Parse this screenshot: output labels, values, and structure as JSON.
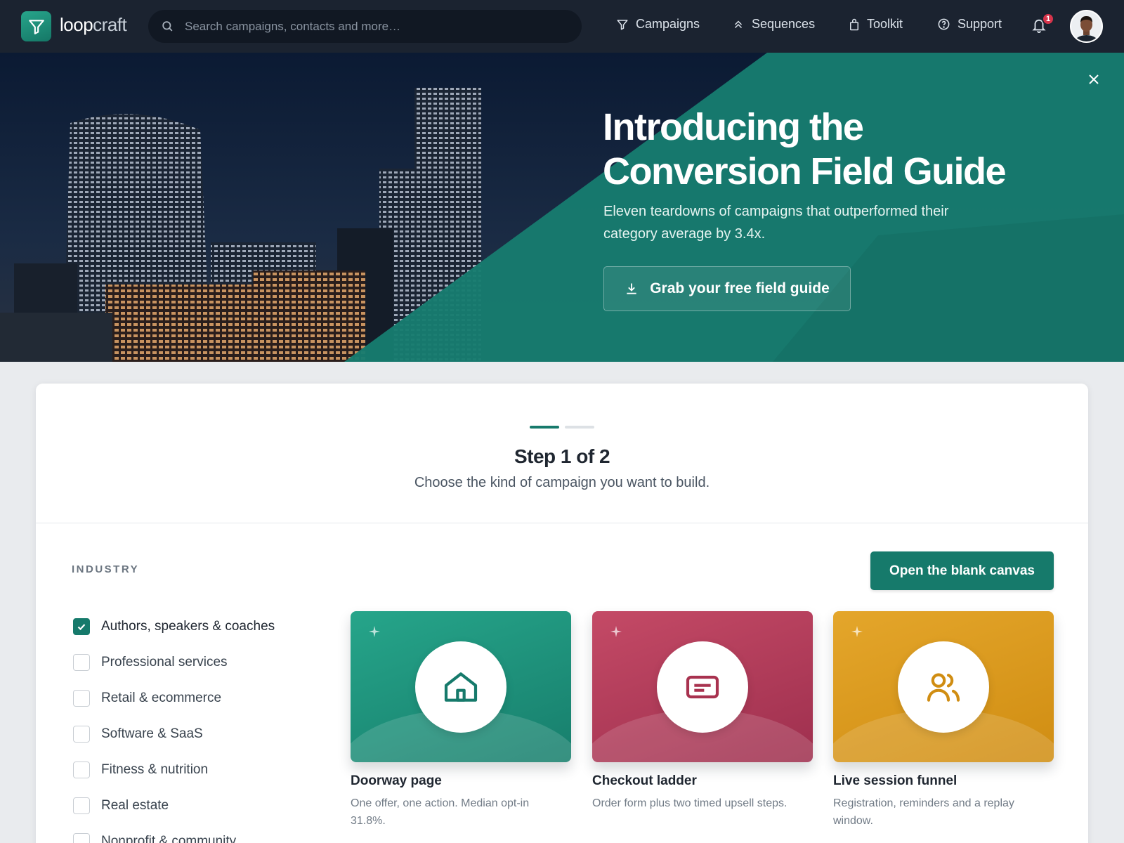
{
  "brand": {
    "name_bold": "loop",
    "name_light": "craft"
  },
  "search": {
    "placeholder": "Search campaigns, contacts and more…"
  },
  "nav": {
    "campaigns": "Campaigns",
    "sequences": "Sequences",
    "toolkit": "Toolkit",
    "support": "Support",
    "notifications_count": "1"
  },
  "hero": {
    "title": "Introducing the Conversion Field Guide",
    "subtitle": "Eleven teardowns of campaigns that outperformed their category average by 3.4x.",
    "cta": "Grab your free field guide"
  },
  "wizard": {
    "step_title": "Step 1 of 2",
    "step_sub": "Choose the kind of campaign you want to build.",
    "industry_label": "INDUSTRY",
    "blank_canvas": "Open the blank canvas",
    "industries": [
      {
        "label": "Authors, speakers & coaches",
        "checked": true
      },
      {
        "label": "Professional services",
        "checked": false
      },
      {
        "label": "Retail & ecommerce",
        "checked": false
      },
      {
        "label": "Software & SaaS",
        "checked": false
      },
      {
        "label": "Fitness & nutrition",
        "checked": false
      },
      {
        "label": "Real estate",
        "checked": false
      },
      {
        "label": "Nonprofit & community",
        "checked": false
      }
    ],
    "templates": [
      {
        "name": "Doorway page",
        "desc": "One offer, one action. Median opt-in 31.8%.",
        "icon": "home-icon",
        "color": "#1f9a80"
      },
      {
        "name": "Checkout ladder",
        "desc": "Order form plus two timed upsell steps.",
        "icon": "card-icon",
        "color": "#b23a5a"
      },
      {
        "name": "Live session funnel",
        "desc": "Registration, reminders and a replay window.",
        "icon": "users-icon",
        "color": "#dd9a19"
      }
    ]
  },
  "colors": {
    "accent": "#167a6b",
    "nav_bg": "#1b2330",
    "badge": "#d6344b"
  }
}
